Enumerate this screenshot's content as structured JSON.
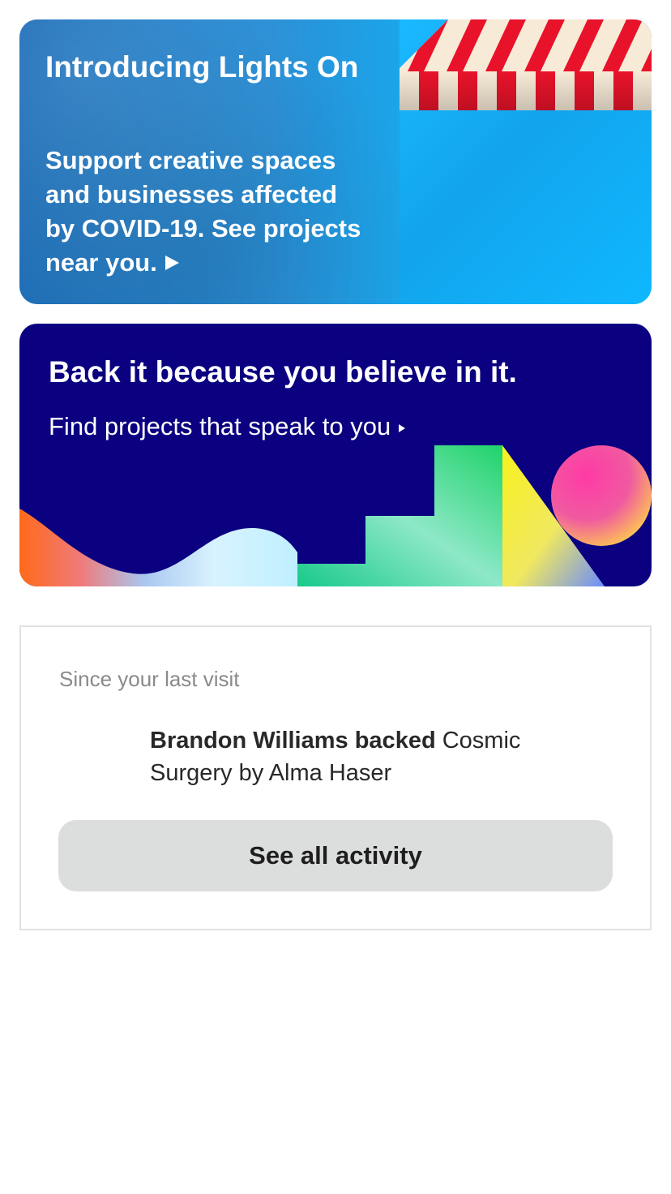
{
  "lights_on_card": {
    "title": "Introducing Lights On",
    "body": "Support creative spaces and businesses affected by COVID-19. See projects near you.",
    "arrow_icon": "play-arrow-icon",
    "colors": {
      "background_start": "#1f6fb8",
      "background_end": "#0fb6fb",
      "awning_red": "#e8132a",
      "awning_cream": "#f7ead7"
    }
  },
  "back_it_card": {
    "headline": "Back it because you believe in it.",
    "link_text": "Find projects that speak to you",
    "arrow_icon": "small-play-arrow-icon",
    "colors": {
      "background": "#0a0080"
    }
  },
  "activity": {
    "section_label": "Since your last visit",
    "entry": {
      "actor_action": "Brandon Williams backed",
      "project": "Cosmic Surgery by Alma Haser"
    },
    "see_all_label": "See all activity"
  }
}
